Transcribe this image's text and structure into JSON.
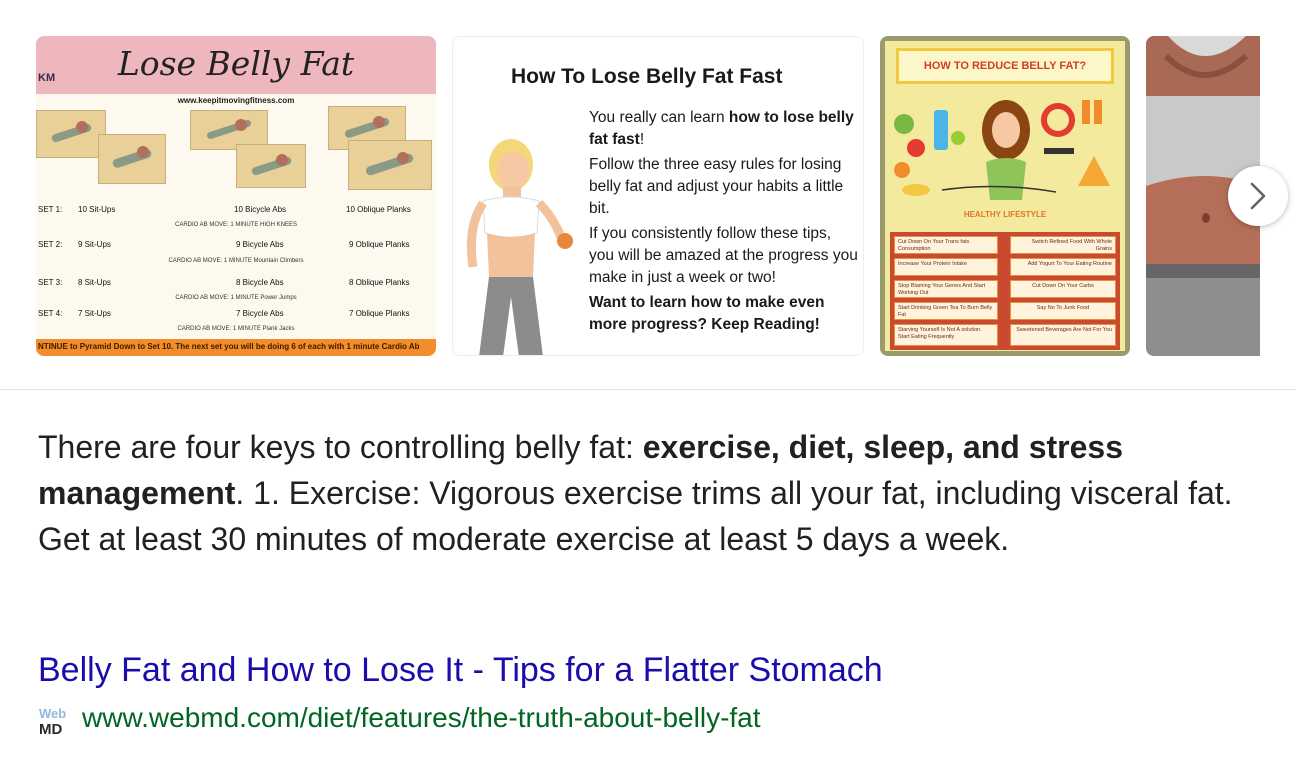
{
  "colors": {
    "link": "#1a0dab",
    "url": "#006621",
    "text": "#202124"
  },
  "carousel": {
    "next_icon": "chevron-right-icon",
    "thumb1": {
      "title": "Lose Belly Fat",
      "logo": "KM",
      "url": "www.keepitmovingfitness.com",
      "rows": [
        {
          "set": "SET 1:",
          "a": "10 Sit-Ups",
          "b": "10 Bicycle Abs",
          "c": "10 Oblique Planks",
          "sub": "CARDIO AB MOVE: 1 MINUTE  HIGH KNEES"
        },
        {
          "set": "SET 2:",
          "a": "9 Sit-Ups",
          "b": "9 Bicycle Abs",
          "c": "9 Oblique Planks",
          "sub": "CARDIO AB MOVE: 1 MINUTE  Mountain Climbers"
        },
        {
          "set": "SET 3:",
          "a": "8 Sit-Ups",
          "b": "8 Bicycle Abs",
          "c": "8 Oblique Planks",
          "sub": "CARDIO AB MOVE: 1 MINUTE  Power Jumps"
        },
        {
          "set": "SET 4:",
          "a": "7 Sit-Ups",
          "b": "7 Bicycle Abs",
          "c": "7 Oblique Planks",
          "sub": "CARDIO AB MOVE: 1 MINUTE  Plank Jacks"
        }
      ],
      "footer": "NTINUE to Pyramid Down to Set 10. The next set you will be doing 6 of each with 1 minute Cardio Ab"
    },
    "thumb2": {
      "title": "How To Lose Belly Fat Fast",
      "p1_pre": "You really can learn ",
      "p1_bold": "how to lose belly fat fast",
      "p1_post": "!",
      "p2": "Follow the three easy rules for losing belly fat and adjust your habits a little bit.",
      "p3": "If you consistently follow these tips, you will be amazed at the progress you make in just a week or two!",
      "p4": "Want to learn how to make even more progress?  Keep Reading!"
    },
    "thumb3": {
      "title": "HOW TO REDUCE BELLY FAT?",
      "headline": "HEALTHY LIFESTYLE",
      "tips": [
        "Cut Down On Your Trans fats Consumption",
        "Switch Refined Food With Whole Grains",
        "Increase Your Protein Intake",
        "Add Yogurt To Your Eating Routine",
        "Stop Blaming Your Genes And Start Working Out",
        "Cut Down On Your Carbs",
        "Start Drinking Green Tea To Burn Belly Fat",
        "Say No To Junk Food",
        "Starving Yourself Is Not A solution. Start Eating Frequently",
        "Sweetened Beverages Are Not For You"
      ]
    }
  },
  "snippet": {
    "pre": "There are four keys to controlling belly fat: ",
    "bold": "exercise, diet, sleep, and stress management",
    "post": ". 1. Exercise: Vigorous exercise trims all your fat, including visceral fat. Get at least 30 minutes of moderate exercise at least 5 days a week."
  },
  "result": {
    "title": "Belly Fat and How to Lose It - Tips for a Flatter Stomach",
    "favicon_text": "Web MD",
    "url": "www.webmd.com/diet/features/the-truth-about-belly-fat"
  }
}
